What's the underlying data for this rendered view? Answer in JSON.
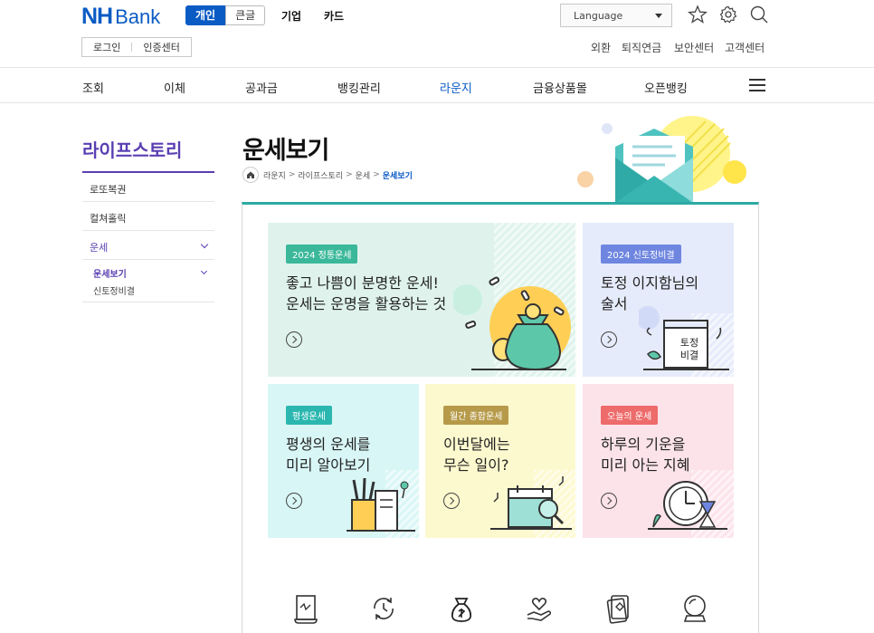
{
  "header": {
    "logo_nh": "NH",
    "logo_bank": "Bank",
    "seg_personal": "개인",
    "seg_large_font": "큰글",
    "nav_corporate": "기업",
    "nav_card": "카드",
    "login": "로그인",
    "cert_center": "인증센터",
    "language": "Language",
    "utility": [
      "외환",
      "퇴직연금",
      "보안센터",
      "고객센터"
    ]
  },
  "gnb": [
    "조회",
    "이체",
    "공과금",
    "뱅킹관리",
    "라운지",
    "금융상품몰",
    "오픈뱅킹"
  ],
  "gnb_active_index": 4,
  "sidebar": {
    "title": "라이프스토리",
    "items": [
      "로또복권",
      "컬쳐홀릭",
      "운세"
    ],
    "sub_active": "운세보기",
    "sub_other": "신토정비결"
  },
  "page": {
    "title": "운세보기",
    "breadcrumb": [
      "라운지",
      "라이프스토리",
      "운세",
      "운세보기"
    ],
    "breadcrumb_sep": ">"
  },
  "cards": [
    {
      "badge": "2024 정통운세",
      "line1": "좋고 나쁨이 분명한 운세!",
      "line2": "운세는 운명을 활용하는 것",
      "bg": "#dff3ec",
      "badge_color": "#3bb89a"
    },
    {
      "badge": "2024 신토정비결",
      "line1": "토정 이지함님의",
      "line2": "술서",
      "bg": "#e6ebfb",
      "badge_color": "#6f86e0",
      "book_line1": "토정",
      "book_line2": "비결"
    },
    {
      "badge": "평생운세",
      "line1": "평생의 운세를",
      "line2": "미리 알아보기",
      "bg": "#d9f6f6",
      "badge_color": "#2bb7b0"
    },
    {
      "badge": "월간 종합운세",
      "line1": "이번달에는",
      "line2": "무슨 일이?",
      "bg": "#fdf9cf",
      "badge_color": "#b69a49"
    },
    {
      "badge": "오늘의 운세",
      "line1": "하루의 기운을",
      "line2": "미리 아는 지혜",
      "bg": "#fce3ea",
      "badge_color": "#ee6b6b"
    }
  ],
  "bottom_icons": [
    "scroll-icon",
    "refresh-cycle-icon",
    "money-bag-icon",
    "heart-hand-icon",
    "playing-card-icon",
    "crystal-ball-icon"
  ],
  "colors": {
    "brand": "#0a5bc4",
    "violet": "#5a3fb2",
    "teal": "#2eaaa4"
  }
}
